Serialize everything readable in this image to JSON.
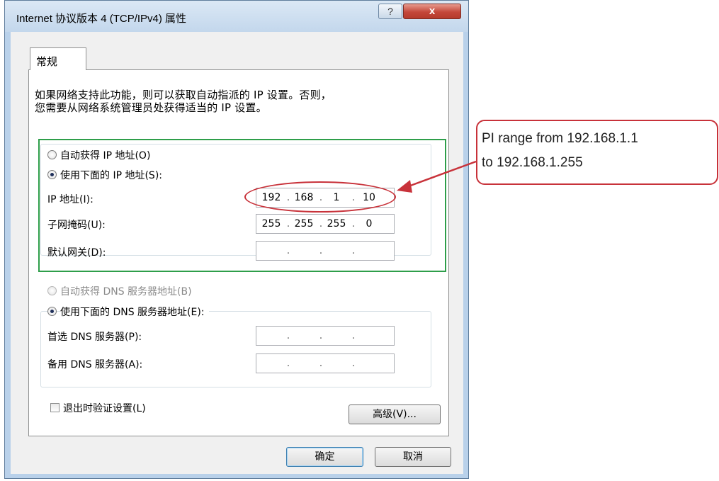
{
  "window": {
    "title": "Internet 协议版本 4 (TCP/IPv4) 属性",
    "help_glyph": "?",
    "close_glyph": "x"
  },
  "tab": {
    "label": "常规"
  },
  "description": {
    "line1": "如果网络支持此功能，则可以获取自动指派的 IP 设置。否则，",
    "line2": "您需要从网络系统管理员处获得适当的 IP 设置。"
  },
  "ip_section": {
    "auto_label": "自动获得 IP 地址(O)",
    "manual_label": "使用下面的 IP 地址(S):",
    "selected": "manual",
    "ip_label": "IP 地址(I):",
    "ip_value": [
      "192",
      "168",
      "1",
      "10"
    ],
    "subnet_label": "子网掩码(U):",
    "subnet_value": [
      "255",
      "255",
      "255",
      "0"
    ],
    "gateway_label": "默认网关(D):",
    "gateway_value": [
      "",
      "",
      "",
      ""
    ]
  },
  "dns_section": {
    "auto_label": "自动获得 DNS 服务器地址(B)",
    "manual_label": "使用下面的 DNS 服务器地址(E):",
    "selected": "manual",
    "preferred_label": "首选 DNS 服务器(P):",
    "preferred_value": [
      "",
      "",
      "",
      ""
    ],
    "alternate_label": "备用 DNS 服务器(A):",
    "alternate_value": [
      "",
      "",
      "",
      ""
    ]
  },
  "validate_checkbox": {
    "label": "退出时验证设置(L)",
    "checked": false
  },
  "buttons": {
    "advanced": "高级(V)...",
    "ok": "确定",
    "cancel": "取消"
  },
  "callout": {
    "line1": "PI range from 192.168.1.1",
    "line2": "to 192.168.1.255"
  },
  "colors": {
    "annotation_red": "#c8323a",
    "highlight_green": "#2e9e4a"
  }
}
